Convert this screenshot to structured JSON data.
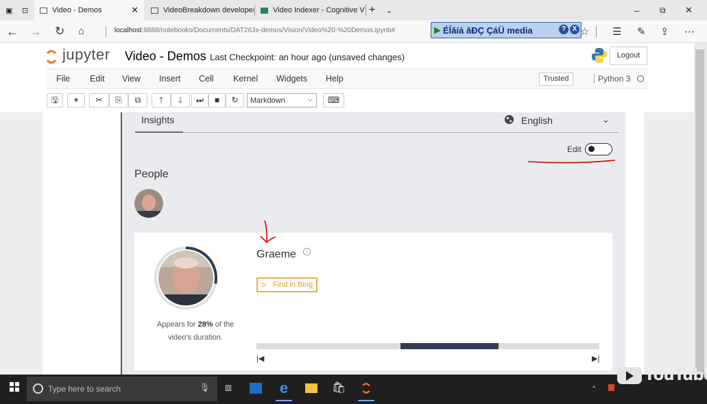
{
  "browser": {
    "tabs": [
      {
        "label": "Video - Demos",
        "active": true,
        "icon": "page-icon"
      },
      {
        "label": "VideoBreakdown developer",
        "active": false,
        "icon": "page-icon"
      },
      {
        "label": "Video Indexer - Cognitive V",
        "active": false,
        "icon": "video-indexer-icon"
      }
    ],
    "url_host": "localhost",
    "url_path": ":8888/notebooks/Documents/DAT263x-demos/Vision/Video%20-%20Demos.ipynb#",
    "media_toolbar_text": "Éĺăíá ăĐÇ ÇáÜ media",
    "media_help": "?",
    "media_close": "X"
  },
  "jupyter": {
    "logo_text": "jupyter",
    "notebook_title": "Video - Demos",
    "checkpoint": "Last Checkpoint: an hour ago (unsaved changes)",
    "logout_label": "Logout",
    "menu": [
      "File",
      "Edit",
      "View",
      "Insert",
      "Cell",
      "Kernel",
      "Widgets",
      "Help"
    ],
    "trusted_label": "Trusted",
    "kernel_name": "Python 3",
    "cell_type": "Markdown"
  },
  "insights": {
    "tab_label": "Insights",
    "language": "English",
    "edit_label": "Edit",
    "edit_enabled": false,
    "people_title": "People",
    "person": {
      "name": "Graeme",
      "bing_label": "Find in Bing",
      "appears_pre": "Appears for ",
      "appears_pct": "28%",
      "appears_mid": " of the",
      "appears_post": "video's duration.",
      "appearance_fraction": 0.28,
      "timeline_segment_start_fraction": 0.42,
      "timeline_segment_end_fraction": 0.705
    }
  },
  "taskbar": {
    "search_placeholder": "Type here to search",
    "youtube_text": "YouTube"
  },
  "colors": {
    "accent_bing": "#f2b13a",
    "timeline_fill": "#2f3f52",
    "annotation_red": "#d40000"
  }
}
